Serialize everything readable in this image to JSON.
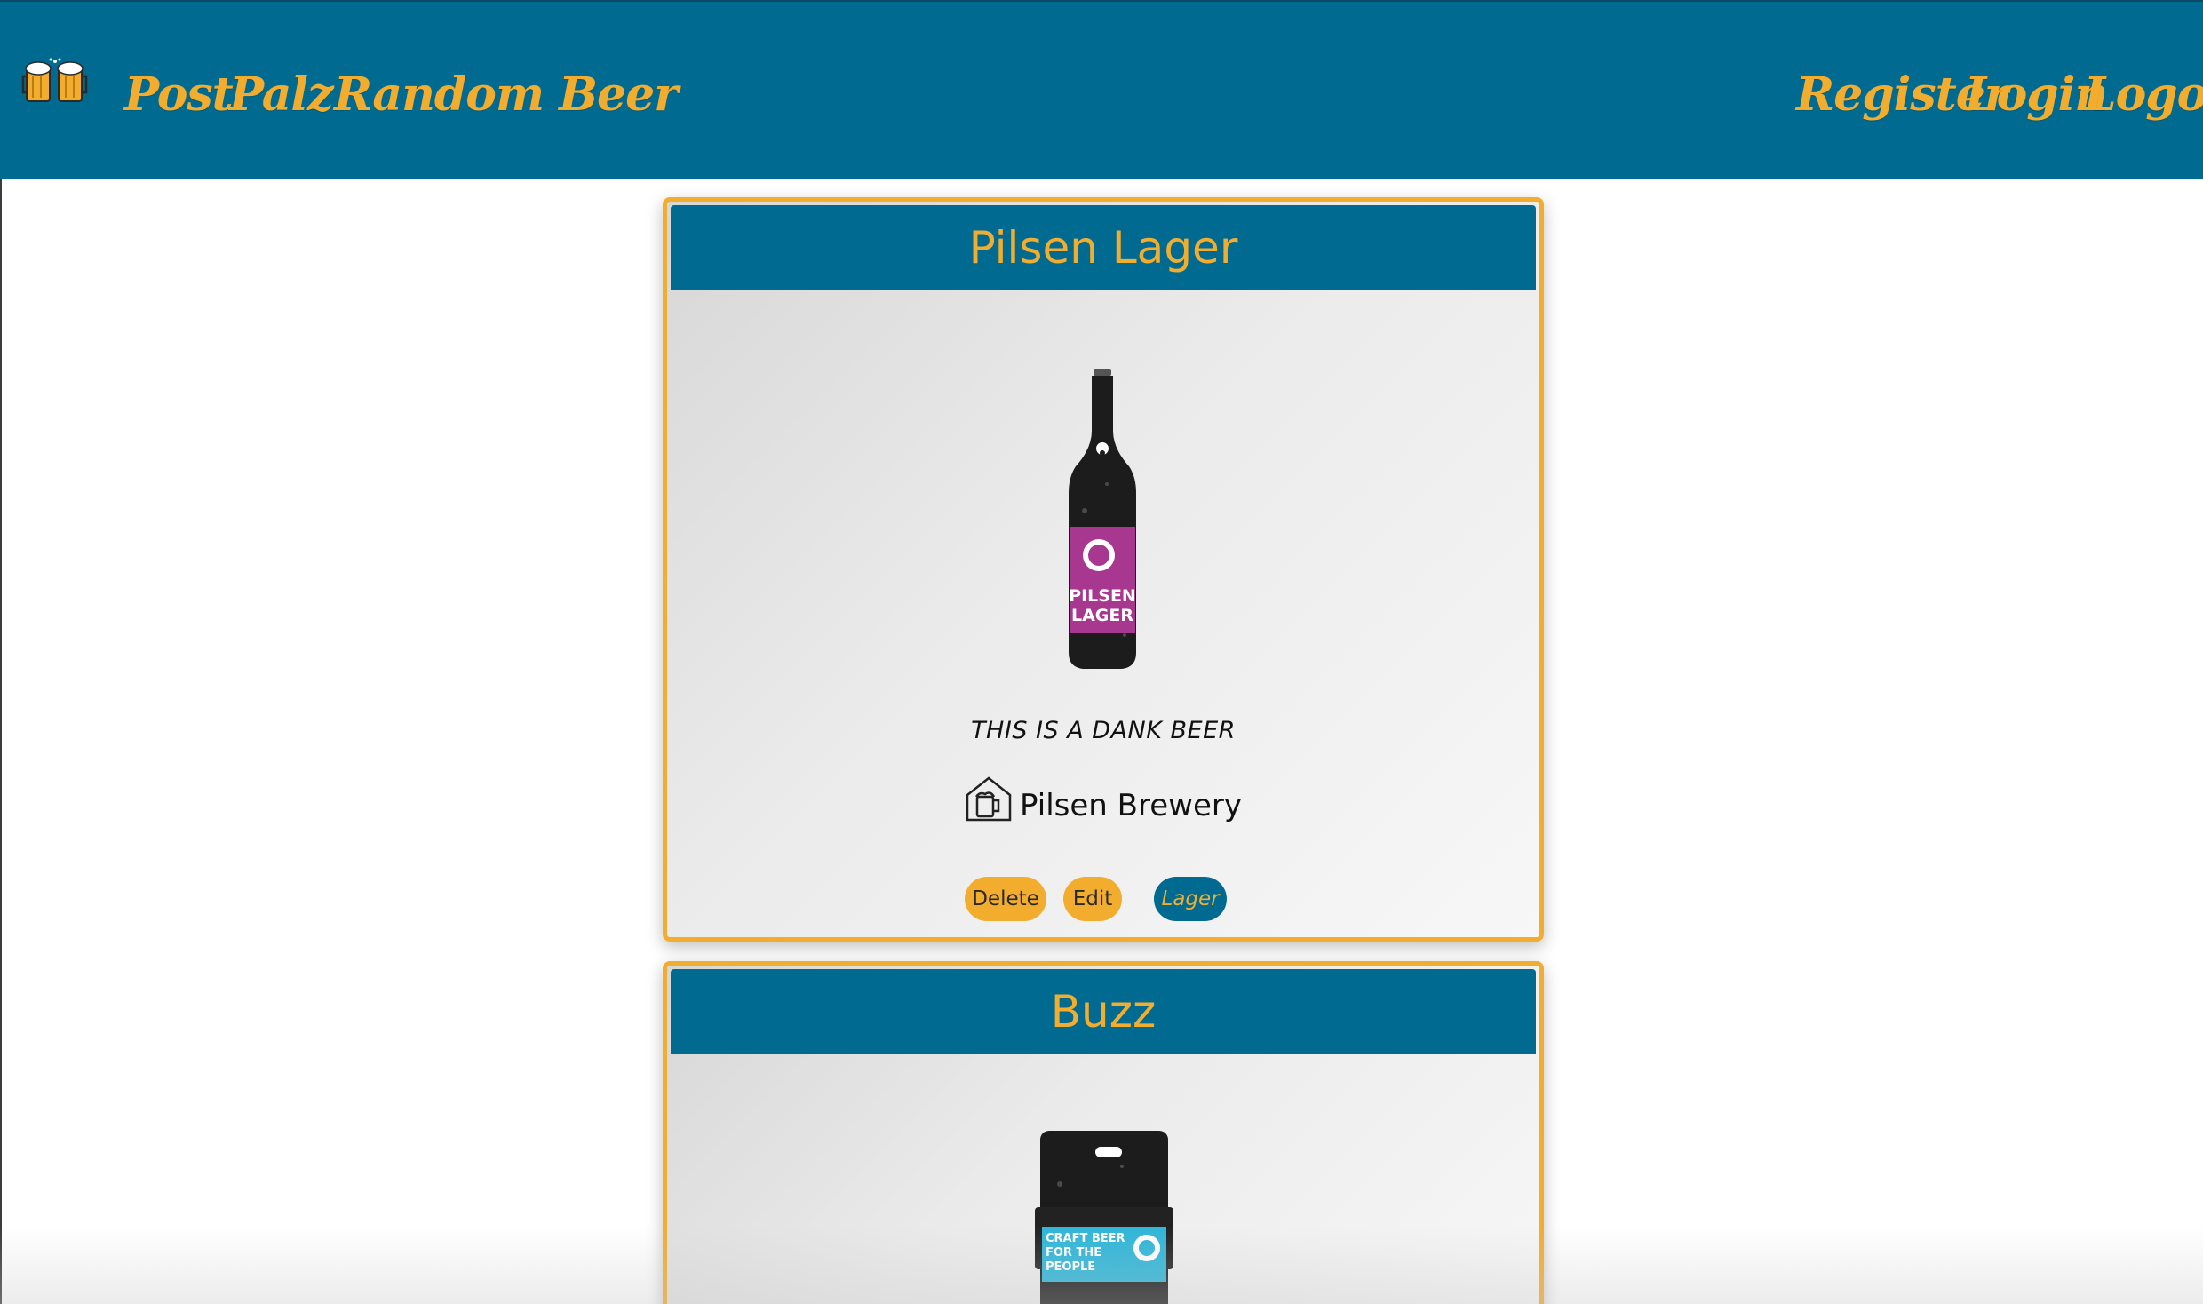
{
  "nav": {
    "brand_icon": "beer-mugs-icon",
    "left_links": [
      "Post",
      "Palz",
      "Random Beer"
    ],
    "right_links": [
      "Register",
      "Login",
      "Logout"
    ]
  },
  "colors": {
    "primary": "#006a91",
    "accent": "#f2ad2f"
  },
  "beers": [
    {
      "name": "Pilsen Lager",
      "description": "THIS IS A DANK BEER",
      "brewery": "Pilsen Brewery",
      "brewery_icon": "brewery-icon",
      "label_text": [
        "PILSEN",
        "LAGER"
      ],
      "buttons": {
        "delete": "Delete",
        "edit": "Edit"
      },
      "tag": "Lager"
    },
    {
      "name": "Buzz",
      "label_text": [
        "CRAFT BEER",
        "FOR THE",
        "PEOPLE"
      ]
    }
  ]
}
